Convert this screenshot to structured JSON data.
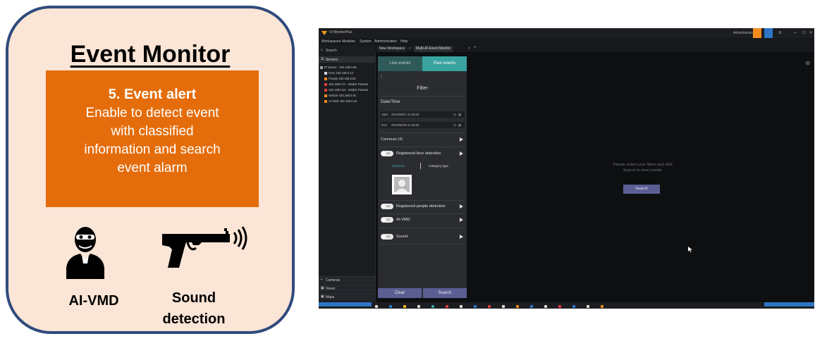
{
  "card": {
    "title": "Event Monitor",
    "alert_title": "5. Event alert",
    "alert_desc_lines": [
      "Enable to detect event",
      "with classified",
      "information and search",
      "event alarm"
    ],
    "label_aivmd": "AI-VMD",
    "label_sound_lines": [
      "Sound",
      "detection"
    ],
    "icons": [
      "robber-mask-icon",
      "gun-sound-icon"
    ],
    "colors": {
      "card_bg": "#fbe5d6",
      "card_border": "#2f4b7c",
      "alert_bg": "#e46c0a"
    }
  },
  "app": {
    "window_title": "VI MonitorPlus",
    "user": "Administrator",
    "menu": [
      "Workspaces",
      "Modules",
      "System",
      "Administration",
      "Help"
    ],
    "sidebar": {
      "search_label": "Search",
      "servers_label": "Servers",
      "tree": [
        "IP Server - 192.168.0.99",
        "Face 192.168.0.12",
        "People 192.168.0.92",
        "192.168.0.71 - Model: Panaso",
        "192.168.0.22 - Model: Panaso",
        "Vehicle 192.168.0.81",
        "AI-VMD 192.168.0.23"
      ],
      "bottom": [
        "Cameras",
        "Views",
        "Maps"
      ]
    },
    "tabs": [
      "New Workspace",
      "Multi-AI Event Monitor"
    ],
    "panel": {
      "tab_live": "Live events",
      "tab_past": "Past events",
      "filter": "Filter",
      "datetime": "Date/Time",
      "start_label": "Start",
      "start_value": "2021/06/27  21:18:03",
      "end_label": "End",
      "end_value": "2021/06/28  21:18:03",
      "cameras": "Cameras (4)",
      "toggle_off": "Off",
      "opt_face": "Registered face detection",
      "sub_watchlist": "Watchlist",
      "sub_category": "Category type",
      "opt_people": "Registered people detection",
      "opt_aivmd": "AI-VMD",
      "opt_sound": "Sound",
      "clear": "Clear",
      "search": "Search"
    },
    "main": {
      "message_line1": "Please select your filters and click",
      "message_line2": "Search to view results.",
      "search": "Search"
    },
    "colors": {
      "accent": "#39a3a0",
      "button": "#5b5e93",
      "bg": "#0e0f11"
    }
  }
}
